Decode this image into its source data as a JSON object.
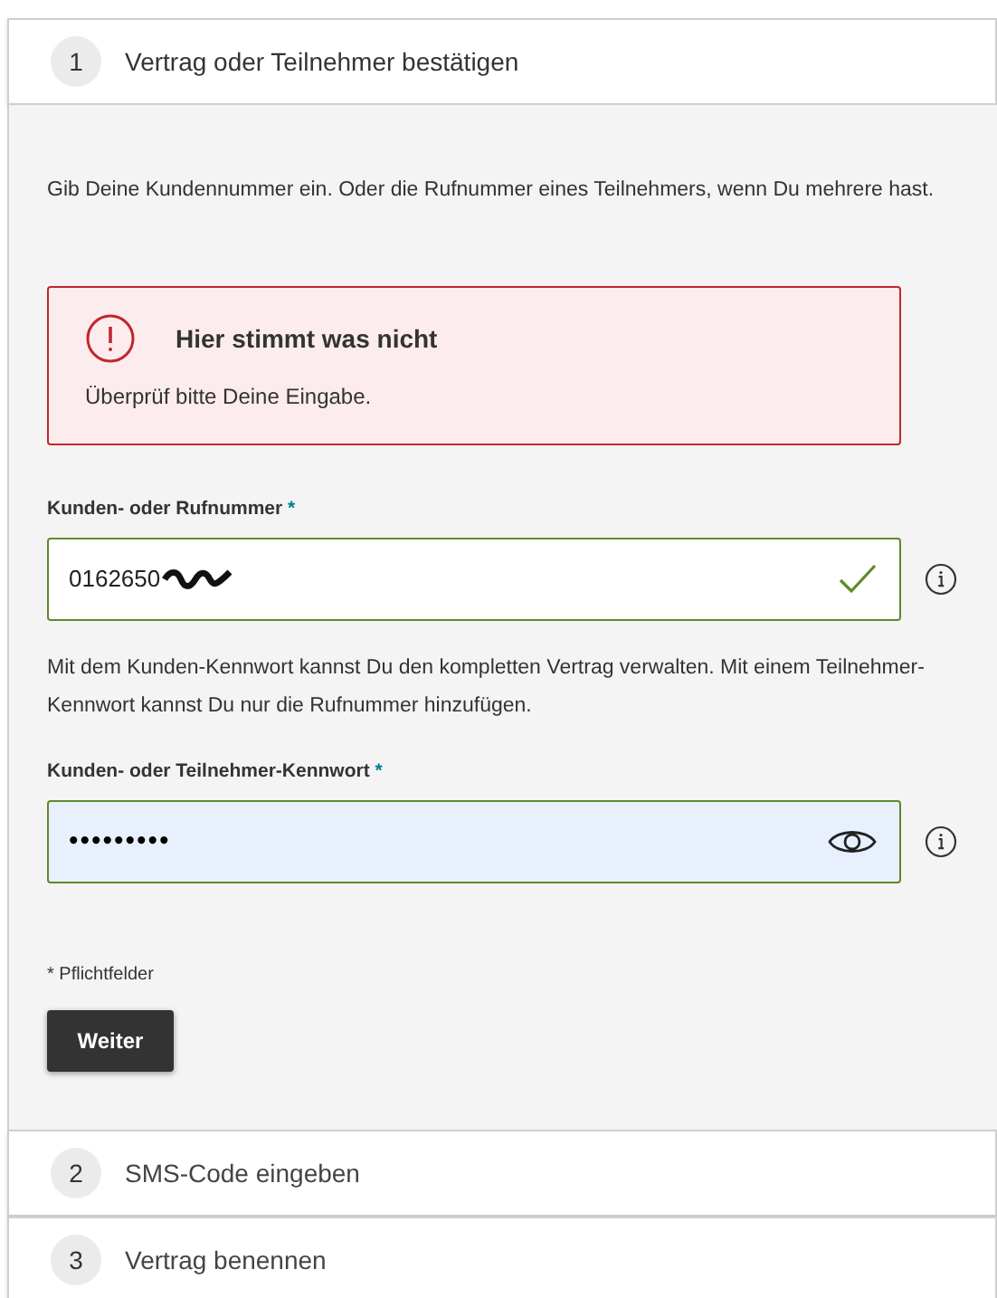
{
  "steps": [
    {
      "number": "1",
      "title": "Vertrag oder Teilnehmer bestätigen",
      "expanded": true
    },
    {
      "number": "2",
      "title": "SMS-Code eingeben",
      "expanded": false
    },
    {
      "number": "3",
      "title": "Vertrag benennen",
      "expanded": false
    }
  ],
  "intro": "Gib Deine Kundennummer ein. Oder die Rufnummer eines Teilnehmers, wenn Du mehrere hast.",
  "alert": {
    "title": "Hier stimmt was nicht",
    "message": "Überprüf bitte Deine Eingabe."
  },
  "fields": [
    {
      "kind": "text",
      "label": "Kunden- oder Rufnummer",
      "required_mark": "*",
      "value": "0162650",
      "valid": true,
      "redacted": true,
      "autofilled": false,
      "hint": "Mit dem Kunden-Kennwort kannst Du den kompletten Vertrag verwalten. Mit einem Teilnehmer-Kennwort kannst Du nur die Rufnummer hinzufügen."
    },
    {
      "kind": "password",
      "label": "Kunden- oder Teilnehmer-Kennwort",
      "required_mark": "*",
      "value": "•••••••••",
      "valid": true,
      "autofilled": true
    }
  ],
  "required_note": "* Pflichtfelder",
  "button": "Weiter"
}
